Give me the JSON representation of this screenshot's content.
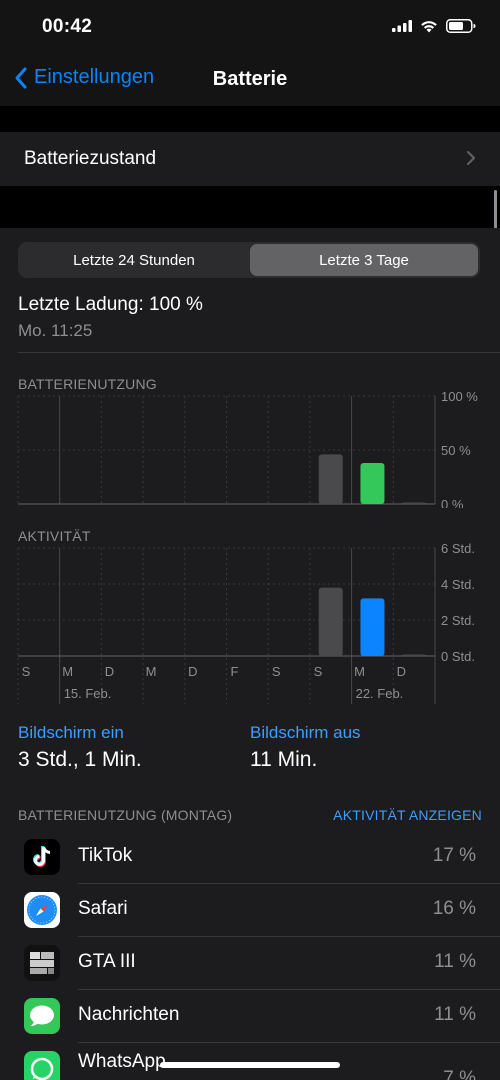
{
  "status_bar": {
    "time": "00:42"
  },
  "nav": {
    "back_label": "Einstellungen",
    "title": "Batterie"
  },
  "battery_health": {
    "label": "Batteriezustand"
  },
  "segmented": {
    "left": "Letzte 24 Stunden",
    "right": "Letzte 3 Tage",
    "selected": "Letzte 3 Tage"
  },
  "last_charge": {
    "text": "Letzte Ladung: 100 %",
    "time": "Mo. 11:25"
  },
  "sections": {
    "battery_usage": "BATTERIENUTZUNG",
    "activity": "AKTIVITÄT"
  },
  "chart_data": [
    {
      "type": "bar",
      "title": "BATTERIENUTZUNG",
      "categories": [
        "S",
        "M",
        "D",
        "M",
        "D",
        "F",
        "S",
        "S",
        "M",
        "D"
      ],
      "values": [
        0,
        0,
        0,
        0,
        0,
        0,
        0,
        46,
        38,
        1
      ],
      "highlight_index": 8,
      "colors": {
        "default": "#4a4a4c",
        "highlight": "#34c759"
      },
      "ylim": [
        0,
        100
      ],
      "yticks": [
        "100 %",
        "50 %",
        "0 %"
      ],
      "ytick_values": [
        100,
        50,
        0
      ],
      "grid": true
    },
    {
      "type": "bar",
      "title": "AKTIVITÄT",
      "categories": [
        "S",
        "M",
        "D",
        "M",
        "D",
        "F",
        "S",
        "S",
        "M",
        "D"
      ],
      "values": [
        0,
        0,
        0,
        0,
        0,
        0,
        0,
        3.8,
        3.2,
        0.05
      ],
      "highlight_index": 8,
      "colors": {
        "default": "#4a4a4c",
        "highlight": "#0a84ff"
      },
      "ylim": [
        0,
        6
      ],
      "yticks": [
        "6 Std.",
        "4 Std.",
        "2 Std.",
        "0 Std."
      ],
      "ytick_values": [
        6,
        4,
        2,
        0
      ],
      "grid": true,
      "week_labels": [
        "15. Feb.",
        "22. Feb."
      ]
    }
  ],
  "screen": {
    "on_label": "Bildschirm ein",
    "on_value": "3 Std., 1 Min.",
    "off_label": "Bildschirm aus",
    "off_value": "11 Min."
  },
  "usage": {
    "header": "BATTERIENUTZUNG (MONTAG)",
    "link": "AKTIVITÄT ANZEIGEN",
    "apps": [
      {
        "name": "TikTok",
        "percent": "17 %",
        "icon": "tiktok-icon"
      },
      {
        "name": "Safari",
        "percent": "16 %",
        "icon": "safari-icon"
      },
      {
        "name": "GTA III",
        "percent": "11 %",
        "icon": "gta-icon"
      },
      {
        "name": "Nachrichten",
        "percent": "11 %",
        "icon": "messages-icon"
      },
      {
        "name": "WhatsApp",
        "percent": "7 %",
        "icon": "whatsapp-icon"
      }
    ]
  }
}
